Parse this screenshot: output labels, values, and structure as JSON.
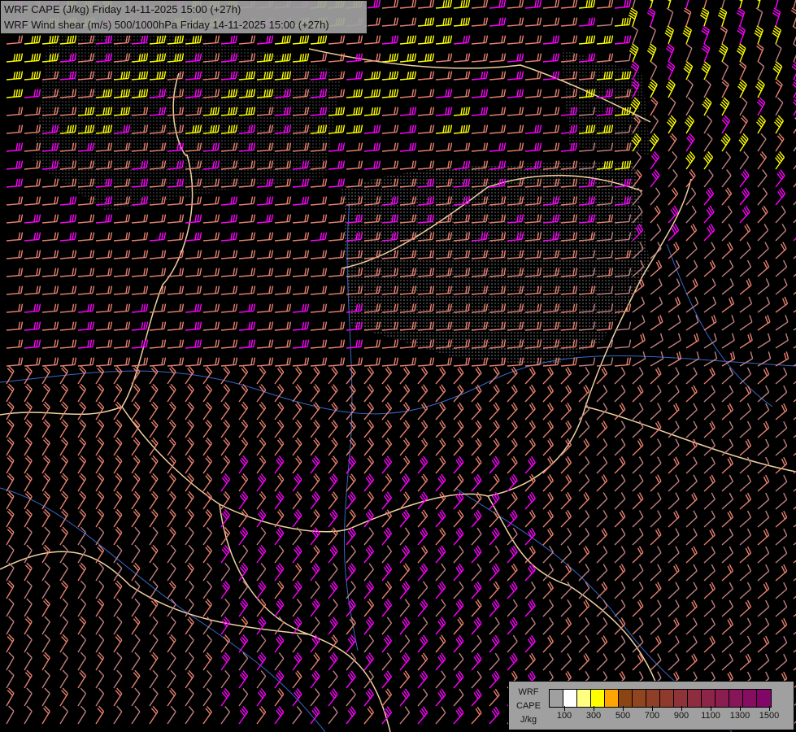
{
  "header": {
    "line1": "WRF CAPE (J/kg) Friday 14-11-2025 15:00 (+27h)",
    "line2": "WRF Wind shear (m/s) 500/1000hPa Friday 14-11-2025 15:00 (+27h)"
  },
  "legend": {
    "title_lines": [
      "WRF",
      "CAPE",
      "J/kg"
    ],
    "colors": [
      "transparent",
      "#ffffff",
      "#ffff80",
      "#ffff00",
      "#ffa500",
      "#8b4513",
      "#8e4520",
      "#8f3f28",
      "#903a2e",
      "#8f3338",
      "#8e2c40",
      "#8c2548",
      "#8a1e50",
      "#871658",
      "#850e60",
      "#820668"
    ],
    "tick_labels": [
      "100",
      "300",
      "500",
      "700",
      "900",
      "1100",
      "1300",
      "1500"
    ]
  },
  "map_colors": {
    "barb_weak": "#c08080",
    "barb_medium": "#e88070",
    "barb_strong": "#ff00ff",
    "barb_very_strong": "#ffff00",
    "border": "#f0d0a0",
    "river": "#3868c8"
  }
}
